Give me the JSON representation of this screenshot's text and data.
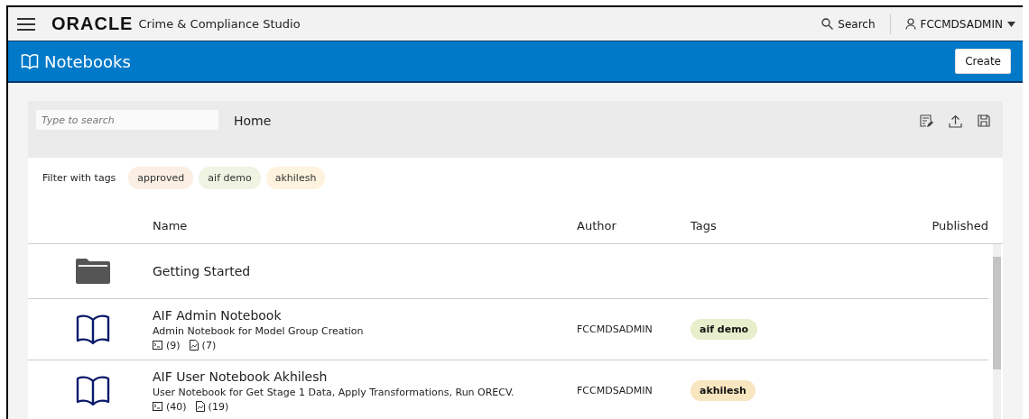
{
  "header": {
    "logo": "ORACLE",
    "product": "Crime & Compliance Studio",
    "search_label": "Search",
    "user": "FCCMDSADMIN"
  },
  "page_bar": {
    "title": "Notebooks",
    "create_button": "Create"
  },
  "toolbar": {
    "search": {
      "placeholder": "Type to search"
    },
    "breadcrumb": "Home"
  },
  "filter": {
    "label": "Filter with tags",
    "tags": [
      {
        "label": "approved",
        "color": "#fbeee3"
      },
      {
        "label": "aif demo",
        "color": "#eef3e2"
      },
      {
        "label": "akhilesh",
        "color": "#fdf3df"
      }
    ]
  },
  "table": {
    "columns": [
      "Name",
      "Author",
      "Tags",
      "Published"
    ],
    "rows": [
      {
        "kind": "folder",
        "name": "Getting Started"
      },
      {
        "kind": "notebook",
        "name": "AIF Admin Notebook",
        "description": "Admin Notebook for Model Group Creation",
        "paragraph_count": "(9)",
        "chart_count": "(7)",
        "author": "FCCMDSADMIN",
        "tags": [
          {
            "label": "aif demo",
            "color": "#e6eecb"
          }
        ]
      },
      {
        "kind": "notebook",
        "name": "AIF User Notebook Akhilesh",
        "description": "User Notebook for Get Stage 1 Data, Apply Transformations, Run ORECV.",
        "paragraph_count": "(40)",
        "chart_count": "(19)",
        "author": "FCCMDSADMIN",
        "tags": [
          {
            "label": "akhilesh",
            "color": "#f8e6c0"
          }
        ]
      }
    ]
  }
}
